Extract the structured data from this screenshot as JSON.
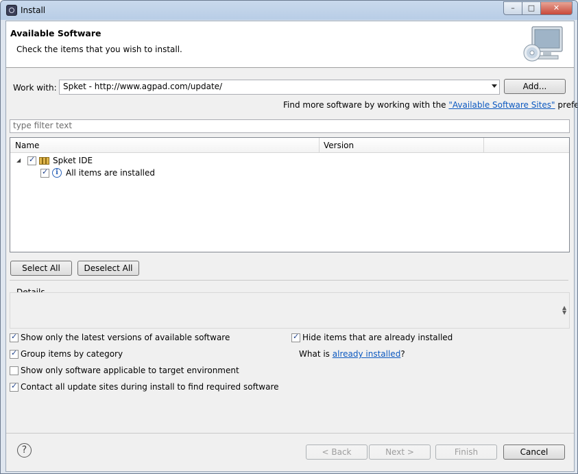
{
  "window": {
    "title": "Install"
  },
  "banner": {
    "title": "Available Software",
    "subtitle": "Check the items that you wish to install."
  },
  "work_with": {
    "label": "Work with:",
    "value": "Spket - http://www.agpad.com/update/",
    "add_button": "Add...",
    "find_more_prefix": "Find more software by working with the",
    "find_more_link": "\"Available Software Sites\"",
    "find_more_suffix": "preferences."
  },
  "filter": {
    "placeholder": "type filter text"
  },
  "tree": {
    "columns": [
      "Name",
      "Version"
    ],
    "rows": [
      {
        "label": "Spket IDE",
        "checked": true,
        "expanded": true,
        "icon": "category-icon"
      },
      {
        "label": "All items are installed",
        "checked": true,
        "icon": "info-icon"
      }
    ]
  },
  "buttons": {
    "select_all": "Select All",
    "deselect_all": "Deselect All"
  },
  "details": {
    "label": "Details"
  },
  "options": {
    "show_latest": {
      "label": "Show only the latest versions of available software",
      "checked": true
    },
    "group_by_category": {
      "label": "Group items by category",
      "checked": true
    },
    "show_applicable": {
      "label": "Show only software applicable to target environment",
      "checked": false
    },
    "contact_sites": {
      "label": "Contact all update sites during install to find required software",
      "checked": true
    },
    "hide_installed": {
      "label": "Hide items that are already installed",
      "checked": true
    },
    "what_is_prefix": "What is",
    "what_is_link": "already installed",
    "what_is_suffix": "?"
  },
  "footer": {
    "back": "< Back",
    "next": "Next >",
    "finish": "Finish",
    "cancel": "Cancel"
  },
  "colors": {
    "link": "#0b58c0",
    "titlebar": "#b8cde6",
    "close": "#c8483a"
  }
}
